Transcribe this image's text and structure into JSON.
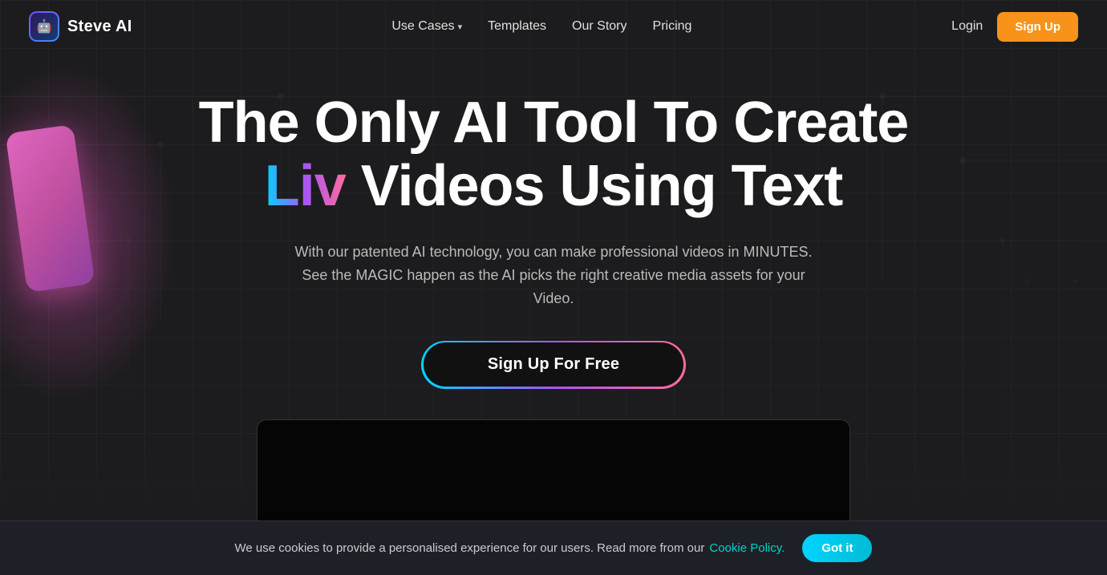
{
  "brand": {
    "name": "Steve AI",
    "logo_icon": "🤖"
  },
  "nav": {
    "use_cases_label": "Use Cases",
    "templates_label": "Templates",
    "our_story_label": "Our Story",
    "pricing_label": "Pricing",
    "login_label": "Login",
    "signup_label": "Sign Up"
  },
  "hero": {
    "title_line1": "The Only AI Tool To Create",
    "title_word_highlight": "Liv",
    "title_line2_rest": " Videos Using Text",
    "subtitle_line1": "With our patented AI technology, you can make professional videos in MINUTES.",
    "subtitle_line2": "See the MAGIC happen as the AI picks the right creative media assets for your Video.",
    "cta_label": "Sign Up For Free"
  },
  "cookie": {
    "text": "We use cookies to provide a personalised experience for our users. Read more from our",
    "link_text": "Cookie Policy.",
    "accept_label": "Got it"
  }
}
